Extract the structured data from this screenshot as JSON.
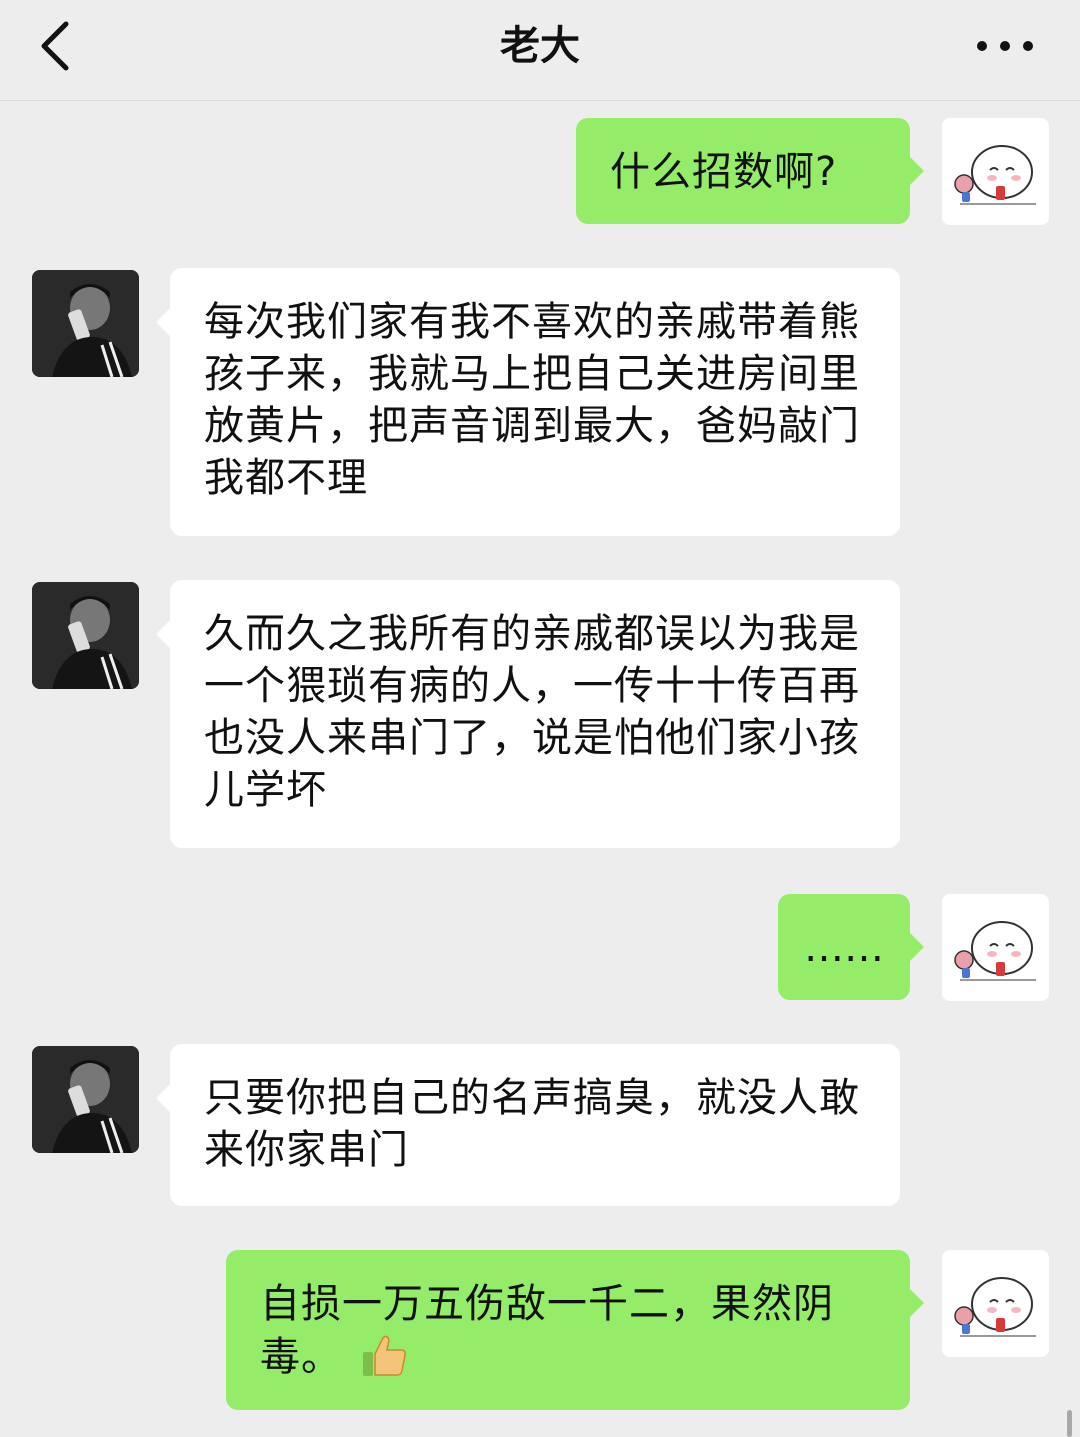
{
  "header": {
    "title": "老大",
    "back_icon": "chevron-left-icon",
    "more_icon": "ellipsis-icon"
  },
  "messages": [
    {
      "sender": "self",
      "text": "什么招数啊?"
    },
    {
      "sender": "other",
      "text": "每次我们家有我不喜欢的亲戚带着熊孩子来，我就马上把自己关进房间里放黄片，把声音调到最大，爸妈敲门我都不理"
    },
    {
      "sender": "other",
      "text": "久而久之我所有的亲戚都误以为我是一个猥琐有病的人，一传十十传百再也没人来串门了，说是怕他们家小孩儿学坏"
    },
    {
      "sender": "self",
      "text": "……"
    },
    {
      "sender": "other",
      "text": "只要你把自己的名声搞臭，就没人敢来你家串门"
    },
    {
      "sender": "self",
      "text": "自损一万五伤敌一千二，果然阴毒。",
      "emoji": "thumbs-up-icon"
    }
  ],
  "colors": {
    "background": "#ededed",
    "self_bubble": "#95ec69",
    "other_bubble": "#ffffff"
  }
}
